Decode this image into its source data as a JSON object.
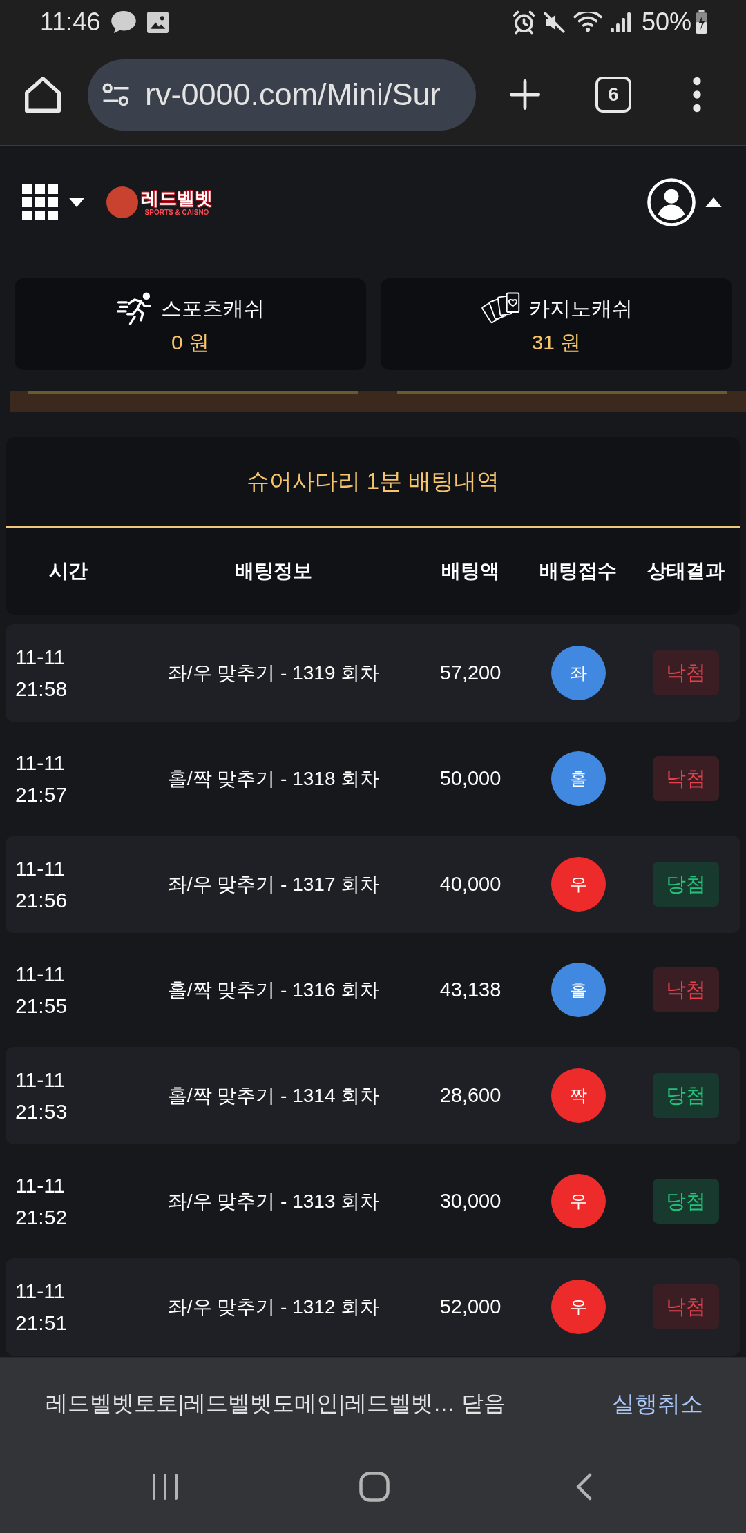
{
  "status_bar": {
    "time": "11:46",
    "battery": "50%"
  },
  "browser_toolbar": {
    "url": "rv-0000.com/Mini/Sur",
    "tab_count": "6"
  },
  "site_header": {
    "logo": {
      "title": "레드벨벳",
      "subtitle": "SPORTS & CAISNO"
    }
  },
  "wallets": [
    {
      "kind": "sports",
      "label": "스포츠캐쉬",
      "amount": "0 원"
    },
    {
      "kind": "casino",
      "label": "카지노캐쉬",
      "amount": "31 원"
    }
  ],
  "history": {
    "title": "슈어사다리 1분 배팅내역",
    "columns": [
      "시간",
      "배팅정보",
      "배팅액",
      "배팅접수",
      "상태결과"
    ],
    "rows": [
      {
        "date": "11-11",
        "time": "21:58",
        "bet_info": "좌/우 맞추기 - 1319 회차",
        "amount": "57,200",
        "pick": {
          "label": "좌",
          "color": "#4188e0"
        },
        "result": {
          "label": "낙첨",
          "won": false
        }
      },
      {
        "date": "11-11",
        "time": "21:57",
        "bet_info": "홀/짝 맞추기 - 1318 회차",
        "amount": "50,000",
        "pick": {
          "label": "홀",
          "color": "#4188e0"
        },
        "result": {
          "label": "낙첨",
          "won": false
        }
      },
      {
        "date": "11-11",
        "time": "21:56",
        "bet_info": "좌/우 맞추기 - 1317 회차",
        "amount": "40,000",
        "pick": {
          "label": "우",
          "color": "#ee2b2b"
        },
        "result": {
          "label": "당첨",
          "won": true
        }
      },
      {
        "date": "11-11",
        "time": "21:55",
        "bet_info": "홀/짝 맞추기 - 1316 회차",
        "amount": "43,138",
        "pick": {
          "label": "홀",
          "color": "#4188e0"
        },
        "result": {
          "label": "낙첨",
          "won": false
        }
      },
      {
        "date": "11-11",
        "time": "21:53",
        "bet_info": "홀/짝 맞추기 - 1314 회차",
        "amount": "28,600",
        "pick": {
          "label": "짝",
          "color": "#ee2b2b"
        },
        "result": {
          "label": "당첨",
          "won": true
        }
      },
      {
        "date": "11-11",
        "time": "21:52",
        "bet_info": "좌/우 맞추기 - 1313 회차",
        "amount": "30,000",
        "pick": {
          "label": "우",
          "color": "#ee2b2b"
        },
        "result": {
          "label": "당첨",
          "won": true
        }
      },
      {
        "date": "11-11",
        "time": "21:51",
        "bet_info": "좌/우 맞추기 - 1312 회차",
        "amount": "52,000",
        "pick": {
          "label": "우",
          "color": "#ee2b2b"
        },
        "result": {
          "label": "낙첨",
          "won": false
        }
      }
    ]
  },
  "snackbar": {
    "message": "레드벨벳토토|레드벨벳도메인|레드벨벳… 닫음",
    "action": "실행취소"
  }
}
